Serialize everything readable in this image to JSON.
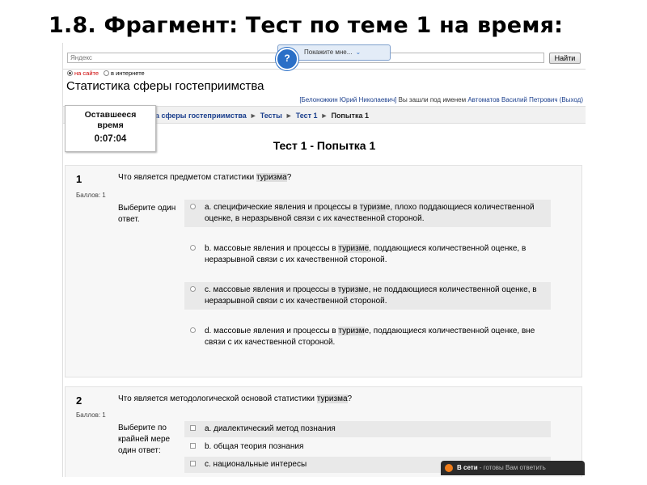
{
  "slide_title": "1.8. Фрагмент: Тест по теме 1 на время:",
  "search": {
    "placeholder": "Яндекс",
    "button": "Найти"
  },
  "scope": {
    "site": "на сайте",
    "web": "в интернете"
  },
  "help": {
    "icon": "?",
    "label": "Покажите мне...",
    "chevron": "⌄"
  },
  "site_title": "Статистика сферы гостеприимства",
  "user": {
    "name": "[Белоножкин Юрий Николаевич]",
    "logged_prefix": " Вы зашли под именем ",
    "logged_as": "Автоматов Василий Петрович",
    "logout": "(Выход)"
  },
  "breadcrumb": {
    "course_part": "ика сферы гостеприимства",
    "tests": "Тесты",
    "test": "Тест 1",
    "attempt": "Попытка 1",
    "sep": "►"
  },
  "timer": {
    "label_line1": "Оставшееся",
    "label_line2": "время",
    "value": "0:07:04"
  },
  "attempt_title": "Тест 1 - Попытка 1",
  "questions": [
    {
      "number": "1",
      "score": "Баллов: 1",
      "text_before": "Что является предметом статистики ",
      "highlight": "туризма",
      "text_after": "?",
      "prompt": "Выберите один ответ.",
      "type": "radio",
      "options": [
        {
          "before": "a. специфические явления и процессы в ",
          "hl": "туризм",
          "after": "е, плохо поддающиеся количественной оценке, в неразрывной связи с их качественной стороной."
        },
        {
          "before": "b. массовые явления и процессы в ",
          "hl": "туризме",
          "after": ", поддающиеся количественной оценке, в неразрывной связи с их качественной стороной."
        },
        {
          "before": "c. массовые явления и процессы в ",
          "hl": "туризм",
          "after": "е, не поддающиеся количественной оценке, в неразрывной связи с их качественной стороной."
        },
        {
          "before": "d. массовые явления и процессы в ",
          "hl": "туризм",
          "after": "е, поддающиеся количественной оценке, вне связи с их качественной стороной."
        }
      ]
    },
    {
      "number": "2",
      "score": "Баллов: 1",
      "text_before": "Что является методологической основой статистики ",
      "highlight": "туризма",
      "text_after": "?",
      "prompt": "Выберите по крайней мере один ответ:",
      "type": "checkbox",
      "options": [
        {
          "before": "a. диалектический метод познания",
          "hl": "",
          "after": ""
        },
        {
          "before": "b. общая теория познания",
          "hl": "",
          "after": ""
        },
        {
          "before": "c. национальные интересы",
          "hl": "",
          "after": ""
        }
      ]
    }
  ],
  "chat": {
    "title": "В сети",
    "subtitle": " - готовы Вам ответить"
  }
}
